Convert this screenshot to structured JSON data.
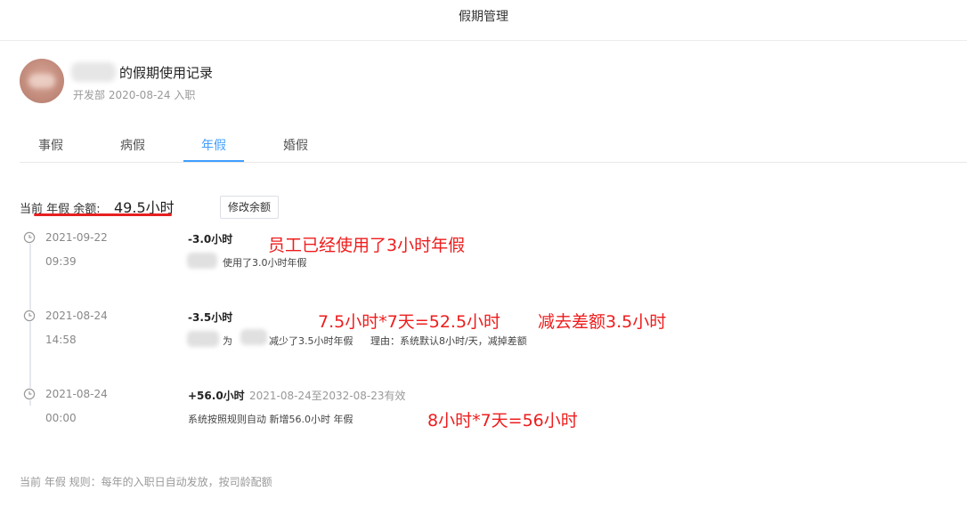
{
  "header": {
    "title": "假期管理"
  },
  "user": {
    "title": "的假期使用记录",
    "subtitle": "开发部 2020-08-24 入职"
  },
  "tabs": [
    {
      "label": "事假",
      "active": false
    },
    {
      "label": "病假",
      "active": false
    },
    {
      "label": "年假",
      "active": true
    },
    {
      "label": "婚假",
      "active": false
    }
  ],
  "balance": {
    "prefix": "当前 年假 余额:",
    "value": "49.5小时",
    "edit_button": "修改余额"
  },
  "records": [
    {
      "date": "2021-09-22",
      "time": "09:39",
      "amount": "-3.0小时",
      "desc": "使用了3.0小时年假"
    },
    {
      "date": "2021-08-24",
      "time": "14:58",
      "amount": "-3.5小时",
      "desc_a": "为",
      "desc_b": "减少了3.5小时年假",
      "desc_reason": "理由：系统默认8小时/天，减掉差额"
    },
    {
      "date": "2021-08-24",
      "time": "00:00",
      "amount": "+56.0小时",
      "validity": "2021-08-24至2032-08-23有效",
      "desc": "系统按照规则自动 新增56.0小时 年假"
    }
  ],
  "annotations": {
    "a1": "员工已经使用了3小时年假",
    "a2": "7.5小时*7天=52.5小时",
    "a3": "减去差额3.5小时",
    "a4": "8小时*7天=56小时"
  },
  "rule_text": "当前 年假 规则：每年的入职日自动发放，按司龄配额",
  "colors": {
    "accent": "#409eff",
    "annotation": "#ee1c1c"
  }
}
